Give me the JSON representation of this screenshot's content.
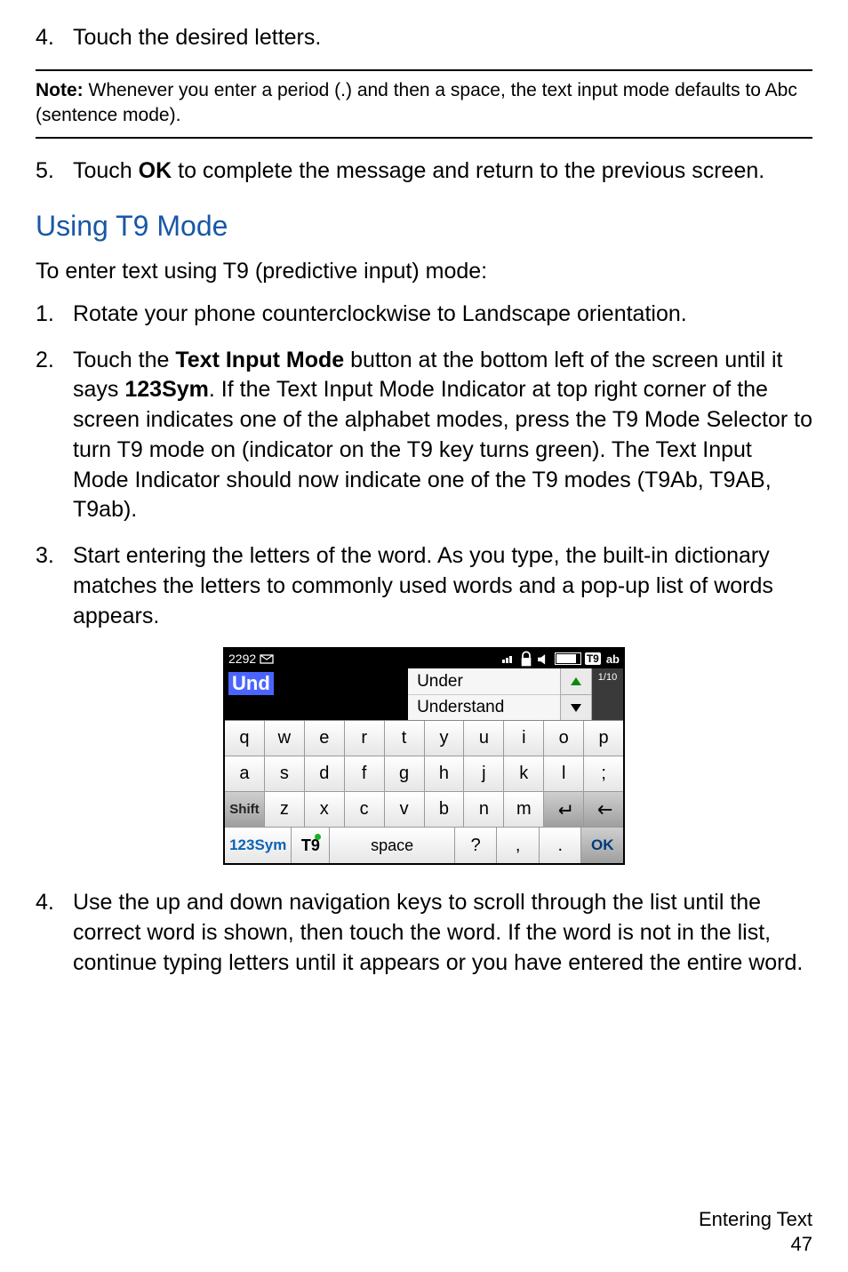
{
  "steps_a": {
    "s4": {
      "num": "4.",
      "text": "Touch the desired letters."
    },
    "s5": {
      "num": "5.",
      "pre": "Touch ",
      "bold": "OK",
      "post": " to complete the message and return to the previous screen."
    }
  },
  "note": {
    "label": "Note:",
    "text": " Whenever you enter a period (.) and then a space, the text input mode defaults to Abc (sentence mode)."
  },
  "section_title": "Using T9 Mode",
  "intro": "To enter text using T9 (predictive input) mode:",
  "steps_b": {
    "s1": {
      "num": "1.",
      "text": "Rotate your phone counterclockwise to Landscape orientation."
    },
    "s2": {
      "num": "2.",
      "p0": "Touch the ",
      "b0": "Text Input Mode",
      "p1": " button at the bottom left of the screen until it says ",
      "b1": "123Sym",
      "p2": ". If the Text Input Mode Indicator at top right corner of the screen indicates one of the alphabet modes, press the T9 Mode Selector to turn T9 mode on (indicator on the T9 key turns green). The Text Input Mode Indicator should now indicate one of the T9 modes (T9Ab, T9AB, T9ab)."
    },
    "s3": {
      "num": "3.",
      "text": "Start entering the letters of the word. As you type, the built-in dictionary matches the letters to commonly used words and a pop-up list of words appears."
    },
    "s4": {
      "num": "4.",
      "text": "Use the up and down navigation keys to scroll through the list until the correct word is shown, then touch the word. If the word is not in the list, continue typing letters until it appears or you have entered the entire word."
    }
  },
  "phone": {
    "status_time": "2292",
    "t9badge": "T9",
    "t9ab": "ab",
    "typed": "Und",
    "suggestion1": "Under",
    "suggestion2": "Understand",
    "count": "1/10",
    "row1": [
      "q",
      "w",
      "e",
      "r",
      "t",
      "y",
      "u",
      "i",
      "o",
      "p"
    ],
    "row2": [
      "a",
      "s",
      "d",
      "f",
      "g",
      "h",
      "j",
      "k",
      "l",
      ";"
    ],
    "row3": {
      "shift": "Shift",
      "keys": [
        "z",
        "x",
        "c",
        "v",
        "b",
        "n",
        "m"
      ]
    },
    "row4": {
      "mode": "123Sym",
      "t9": "T9",
      "space": "space",
      "q": "?",
      "comma": ",",
      "dot": ".",
      "ok": "OK"
    }
  },
  "footer": {
    "section": "Entering Text",
    "page": "47"
  }
}
